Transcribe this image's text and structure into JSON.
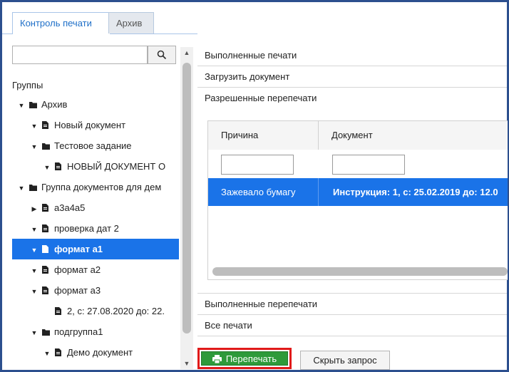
{
  "tabs": [
    {
      "label": "Контроль печати",
      "active": true
    },
    {
      "label": "Архив",
      "active": false
    }
  ],
  "left": {
    "search": {
      "value": "",
      "icon": "search-icon"
    },
    "groups_label": "Группы",
    "tree": [
      {
        "label": "Архив",
        "level": 0,
        "expanded": true,
        "icon": "folder-icon",
        "selected": false
      },
      {
        "label": "Новый документ",
        "level": 1,
        "expanded": true,
        "icon": "document-icon",
        "selected": false
      },
      {
        "label": "Тестовое задание",
        "level": 1,
        "expanded": true,
        "icon": "folder-icon",
        "selected": false
      },
      {
        "label": "НОВЫЙ ДОКУМЕНТ О",
        "level": 2,
        "expanded": true,
        "icon": "document-icon",
        "selected": false
      },
      {
        "label": "Группа документов для дем",
        "level": 0,
        "expanded": true,
        "icon": "folder-icon",
        "selected": false
      },
      {
        "label": "а3а4а5",
        "level": 1,
        "expanded": false,
        "icon": "document-icon",
        "selected": false
      },
      {
        "label": "проверка дат 2",
        "level": 1,
        "expanded": true,
        "icon": "document-icon",
        "selected": false
      },
      {
        "label": "формат а1",
        "level": 1,
        "expanded": true,
        "icon": "document-icon",
        "selected": true
      },
      {
        "label": "формат а2",
        "level": 1,
        "expanded": true,
        "icon": "document-icon",
        "selected": false
      },
      {
        "label": "формат а3",
        "level": 1,
        "expanded": true,
        "icon": "document-icon",
        "selected": false
      },
      {
        "label": "2, с: 27.08.2020 до: 22.",
        "level": 2,
        "expanded": null,
        "icon": "document-icon",
        "selected": false
      },
      {
        "label": "подгруппа1",
        "level": 1,
        "expanded": true,
        "icon": "folder-icon",
        "selected": false
      },
      {
        "label": "Демо документ",
        "level": 2,
        "expanded": true,
        "icon": "document-icon",
        "selected": false
      }
    ]
  },
  "right": {
    "sections": [
      "Выполненные печати",
      "Загрузить документ",
      "Разрешенные перепечати",
      "Выполненные перепечати",
      "Все печати"
    ],
    "grid": {
      "columns": [
        "Причина",
        "Документ"
      ],
      "filters": [
        "",
        ""
      ],
      "rows": [
        {
          "reason": "Зажевало бумагу",
          "document": "Инструкция: 1, с: 25.02.2019 до: 12.0",
          "selected": true
        }
      ]
    },
    "buttons": {
      "reprint": "Перепечать",
      "hide_request": "Скрыть запрос"
    }
  },
  "colors": {
    "accent": "#1a73e8",
    "reprint_green": "#2e9a3a",
    "highlight_red": "#e11a1a",
    "frame_border": "#2c4f8e"
  }
}
